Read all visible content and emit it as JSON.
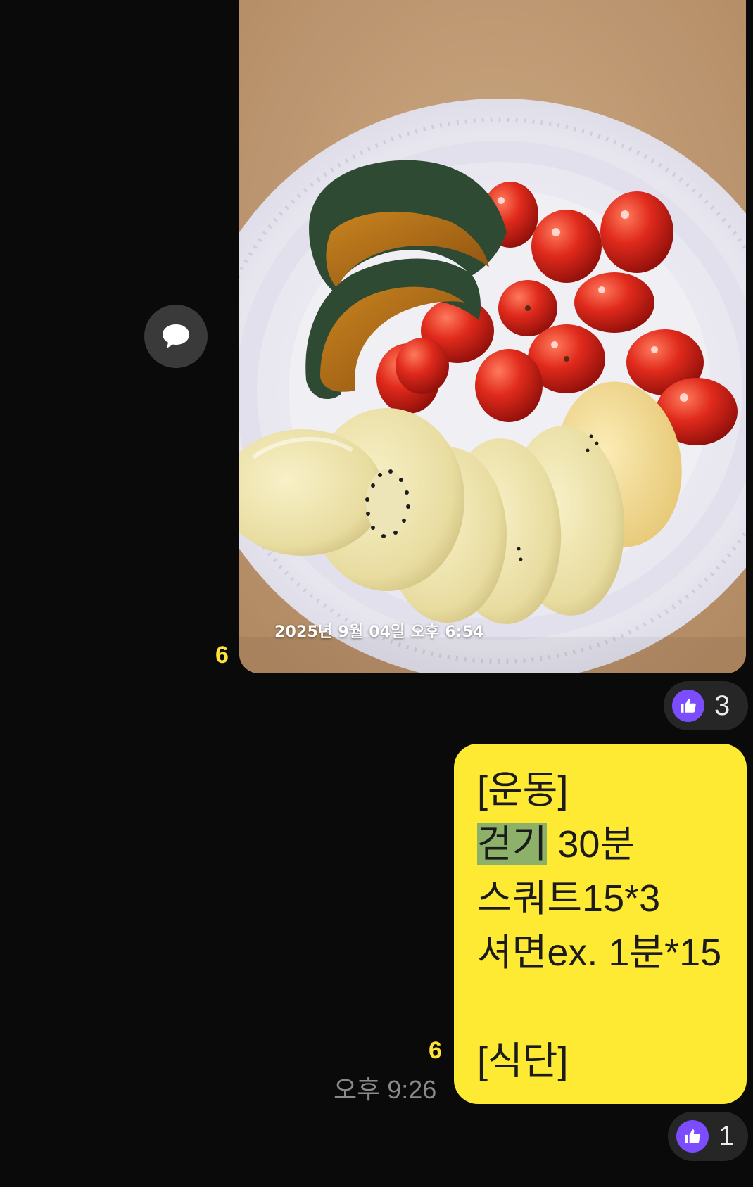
{
  "photo_message": {
    "timestamp": "2025년 9월 04일 오후 6:54",
    "unread_count": "6",
    "reaction_count": "3"
  },
  "comment_button": {
    "icon": "speech-bubble-icon"
  },
  "text_message": {
    "lines": {
      "l1": "[운동]",
      "l2_highlight": "걷기",
      "l2_rest": " 30분",
      "l3": "스쿼트15*3",
      "l4": "셔면ex. 1분*15",
      "l5": "",
      "l6": "[식단]"
    },
    "unread_count": "6",
    "time": "오후 9:26",
    "reaction_count": "1"
  },
  "colors": {
    "background": "#0a0a0a",
    "bubble": "#fee933",
    "unread": "#ffe33b",
    "reaction_badge": "#7c4dff",
    "highlight": "#8eb169"
  }
}
